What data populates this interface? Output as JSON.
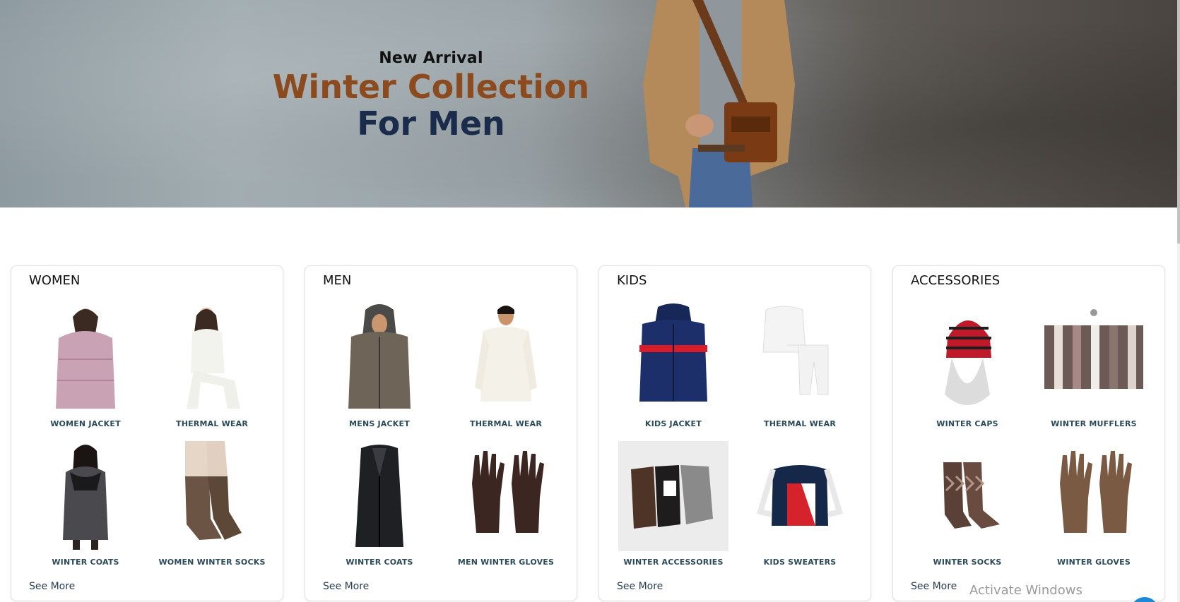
{
  "hero": {
    "subtitle": "New Arrival",
    "title": "Winter Collection",
    "line3": "For Men"
  },
  "cards": [
    {
      "title": "WOMEN",
      "items": [
        {
          "label": "WOMEN JACKET",
          "icon": "women-jacket-image"
        },
        {
          "label": "THERMAL WEAR",
          "icon": "thermal-wear-image"
        },
        {
          "label": "WINTER COATS",
          "icon": "winter-coat-image"
        },
        {
          "label": "WOMEN WINTER SOCKS",
          "icon": "socks-image"
        }
      ],
      "see_more": "See More"
    },
    {
      "title": "MEN",
      "items": [
        {
          "label": "MENS JACKET",
          "icon": "mens-jacket-image"
        },
        {
          "label": "THERMAL WEAR",
          "icon": "thermal-wear-image"
        },
        {
          "label": "WINTER COATS",
          "icon": "winter-coat-image"
        },
        {
          "label": "MEN WINTER GLOVES",
          "icon": "gloves-image"
        }
      ],
      "see_more": "See More"
    },
    {
      "title": "KIDS",
      "items": [
        {
          "label": "KIDS JACKET",
          "icon": "kids-jacket-image"
        },
        {
          "label": "THERMAL WEAR",
          "icon": "thermal-wear-image"
        },
        {
          "label": "WINTER ACCESSORIES",
          "icon": "winter-accessories-image"
        },
        {
          "label": "KIDS SWEATERS",
          "icon": "sweater-image"
        }
      ],
      "see_more": "See More"
    },
    {
      "title": "ACCESSORIES",
      "items": [
        {
          "label": "WINTER CAPS",
          "icon": "cap-image"
        },
        {
          "label": "WINTER MUFFLERS",
          "icon": "mufflers-image"
        },
        {
          "label": "WINTER SOCKS",
          "icon": "socks-image"
        },
        {
          "label": "WINTER GLOVES",
          "icon": "gloves-image"
        }
      ],
      "see_more": "See More"
    }
  ],
  "watermark": "Activate Windows",
  "colors": {
    "label": "#2c4a5a",
    "title_brown": "#8c4a1f",
    "title_navy": "#1b2b4b"
  }
}
